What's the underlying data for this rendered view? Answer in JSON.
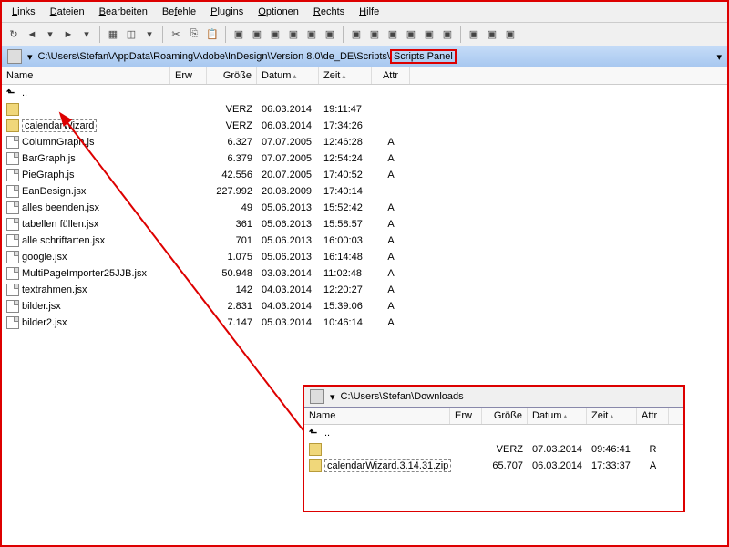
{
  "menu": {
    "items": [
      "Links",
      "Dateien",
      "Bearbeiten",
      "Befehle",
      "Plugins",
      "Optionen",
      "Rechts",
      "Hilfe"
    ]
  },
  "main": {
    "path_prefix": "C:\\Users\\Stefan\\AppData\\Roaming\\Adobe\\InDesign\\Version 8.0\\de_DE\\Scripts\\",
    "path_highlight": "Scripts Panel",
    "headers": {
      "name": "Name",
      "erw": "Erw",
      "size": "Größe",
      "date": "Datum",
      "time": "Zeit",
      "attr": "Attr"
    },
    "rows": [
      {
        "icon": "up",
        "name": "..",
        "erw": "",
        "size": "",
        "date": "",
        "time": "",
        "attr": ""
      },
      {
        "icon": "folder",
        "name": "",
        "erw": "",
        "size": "VERZ",
        "date": "06.03.2014",
        "time": "19:11:47",
        "attr": ""
      },
      {
        "icon": "folder",
        "name": "calendarWizard",
        "selected": true,
        "erw": "",
        "size": "VERZ",
        "date": "06.03.2014",
        "time": "17:34:26",
        "attr": ""
      },
      {
        "icon": "file",
        "name": "ColumnGraph.js",
        "erw": "",
        "size": "6.327",
        "date": "07.07.2005",
        "time": "12:46:28",
        "attr": "A"
      },
      {
        "icon": "file",
        "name": "BarGraph.js",
        "erw": "",
        "size": "6.379",
        "date": "07.07.2005",
        "time": "12:54:24",
        "attr": "A"
      },
      {
        "icon": "file",
        "name": "PieGraph.js",
        "erw": "",
        "size": "42.556",
        "date": "20.07.2005",
        "time": "17:40:52",
        "attr": "A"
      },
      {
        "icon": "file",
        "name": "EanDesign.jsx",
        "erw": "",
        "size": "227.992",
        "date": "20.08.2009",
        "time": "17:40:14",
        "attr": ""
      },
      {
        "icon": "file",
        "name": "alles beenden.jsx",
        "erw": "",
        "size": "49",
        "date": "05.06.2013",
        "time": "15:52:42",
        "attr": "A"
      },
      {
        "icon": "file",
        "name": "tabellen füllen.jsx",
        "erw": "",
        "size": "361",
        "date": "05.06.2013",
        "time": "15:58:57",
        "attr": "A"
      },
      {
        "icon": "file",
        "name": "alle schriftarten.jsx",
        "erw": "",
        "size": "701",
        "date": "05.06.2013",
        "time": "16:00:03",
        "attr": "A"
      },
      {
        "icon": "file",
        "name": "google.jsx",
        "erw": "",
        "size": "1.075",
        "date": "05.06.2013",
        "time": "16:14:48",
        "attr": "A"
      },
      {
        "icon": "file",
        "name": "MultiPageImporter25JJB.jsx",
        "erw": "",
        "size": "50.948",
        "date": "03.03.2014",
        "time": "11:02:48",
        "attr": "A"
      },
      {
        "icon": "file",
        "name": "textrahmen.jsx",
        "erw": "",
        "size": "142",
        "date": "04.03.2014",
        "time": "12:20:27",
        "attr": "A"
      },
      {
        "icon": "file",
        "name": "bilder.jsx",
        "erw": "",
        "size": "2.831",
        "date": "04.03.2014",
        "time": "15:39:06",
        "attr": "A"
      },
      {
        "icon": "file",
        "name": "bilder2.jsx",
        "erw": "",
        "size": "7.147",
        "date": "05.03.2014",
        "time": "10:46:14",
        "attr": "A"
      }
    ]
  },
  "secondary": {
    "path": "C:\\Users\\Stefan\\Downloads",
    "rows": [
      {
        "icon": "up",
        "name": "..",
        "erw": "",
        "size": "",
        "date": "",
        "time": "",
        "attr": ""
      },
      {
        "icon": "folder",
        "name": "",
        "erw": "",
        "size": "VERZ",
        "date": "07.03.2014",
        "time": "09:46:41",
        "attr": "R"
      },
      {
        "icon": "zip",
        "name": "calendarWizard.3.14.31.zip",
        "selected": true,
        "erw": "",
        "size": "65.707",
        "date": "06.03.2014",
        "time": "17:33:37",
        "attr": "A"
      }
    ]
  }
}
